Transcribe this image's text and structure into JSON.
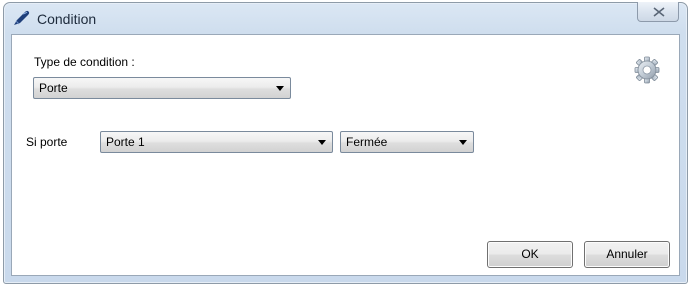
{
  "window": {
    "title": "Condition",
    "close_symbol": "⌧",
    "title_icon": "pen-icon",
    "close_icon": "close-icon"
  },
  "form": {
    "condition_type_label": "Type de condition :",
    "condition_type_value": "Porte",
    "if_door_label": "Si porte",
    "door_value": "Porte 1",
    "state_value": "Fermée"
  },
  "decoration": {
    "icon": "gear-icon"
  },
  "buttons": {
    "ok_label": "OK",
    "cancel_label": "Annuler"
  },
  "colors": {
    "titlebar": "#cfdeee",
    "window_border": "#8e9ba8",
    "client_background": "#ffffff",
    "button_border": "#707070"
  }
}
